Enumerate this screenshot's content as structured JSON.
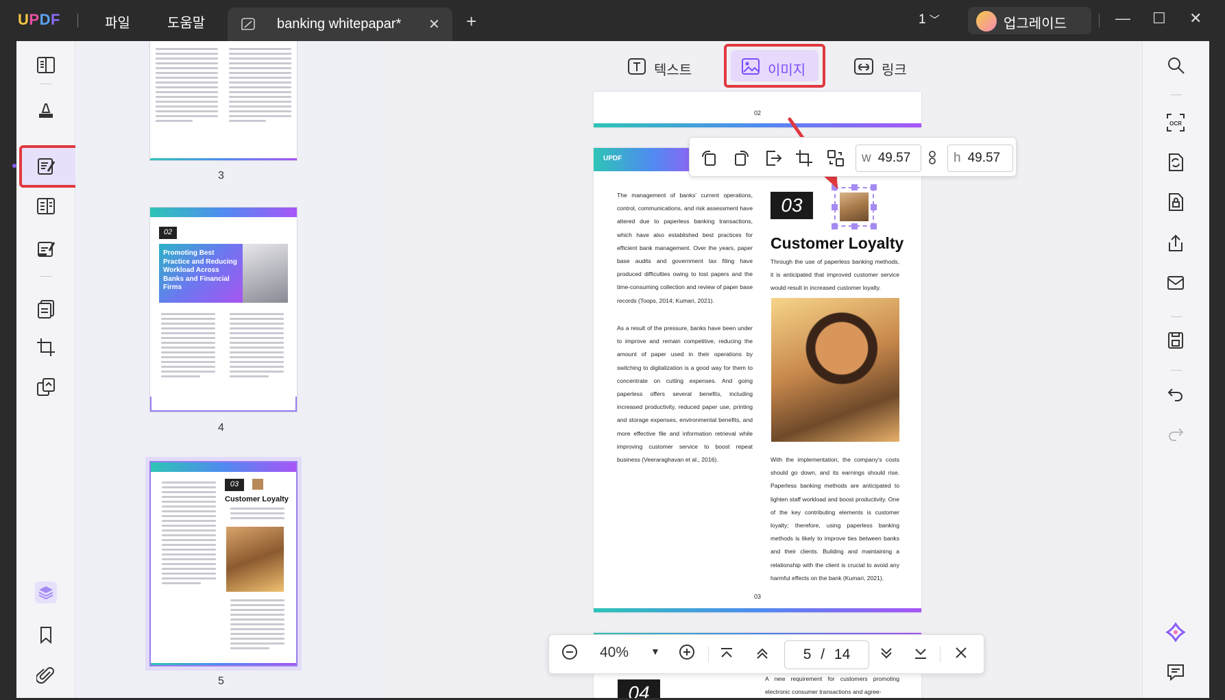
{
  "titlebar": {
    "logo": "UPDF",
    "menu_file": "파일",
    "menu_help": "도움말",
    "tab_title": "banking whitepapar*",
    "page_indicator": "1",
    "upgrade_label": "업그레이드"
  },
  "edit_modes": {
    "text_label": "텍스트",
    "image_label": "이미지",
    "link_label": "링크",
    "active": "image"
  },
  "image_toolbar": {
    "width_label": "w",
    "width_value": "49.57",
    "height_label": "h",
    "height_value": "49.57"
  },
  "thumbnails": [
    {
      "page": "3"
    },
    {
      "page": "4",
      "heading_num": "02",
      "heading": "Promoting Best Practice and Reducing Workload Across Banks and Financial Firms"
    },
    {
      "page": "5",
      "heading_num": "03",
      "heading": "Customer Loyalty",
      "selected": true
    }
  ],
  "document": {
    "prev_page_number": "02",
    "header_brand": "UPDF",
    "section_number": "03",
    "section_title": "Customer Loyalty",
    "section_intro": "Through the use of paperless banking methods, it is anticipated that improved customer service would result in increased customer loyalty.",
    "left_para_1": "The management of banks' current operations, control, communications, and risk assessment have altered due to paperless banking transactions, which have also established best practices for efficient bank management. Over the years, paper base audits and government tax filing have produced difficulties owing to lost papers and the time-consuming collection and review of paper base records (Toops, 2014; Kumari, 2021).",
    "left_para_2": "As a result of the pressure, banks have been under to improve and remain competitive, reducing the amount of paper used in their operations by switching to digitalization is a good way for them to concentrate on cutting expenses. And going paperless offers several benefits, including increased productivity, reduced paper use, printing and storage expenses, environmental benefits, and more effective file and information retrieval while improving customer service to boost repeat business (Veeraraghavan et al., 2016).",
    "right_para": "With the implementation, the company's costs should go down, and its earnings should rise. Paperless banking methods are anticipated to lighten staff workload and boost productivity. One of the key contributing elements is customer loyalty; therefore, using paperless banking methods is likely to improve ties between banks and their clients. Building and maintaining a relationship with the client is crucial to avoid any harmful effects on the bank (Kumari, 2021).",
    "page_number": "03",
    "next_section_number": "04",
    "next_text": "A new requirement for customers promoting electronic consumer transactions and agree-"
  },
  "zoombar": {
    "zoom": "40%",
    "current_page": "5",
    "separator": "/",
    "total_pages": "14"
  },
  "colors": {
    "accent": "#8b5cf6",
    "highlight_red": "#e0393f",
    "titlebar_bg": "#2b2b2b"
  }
}
